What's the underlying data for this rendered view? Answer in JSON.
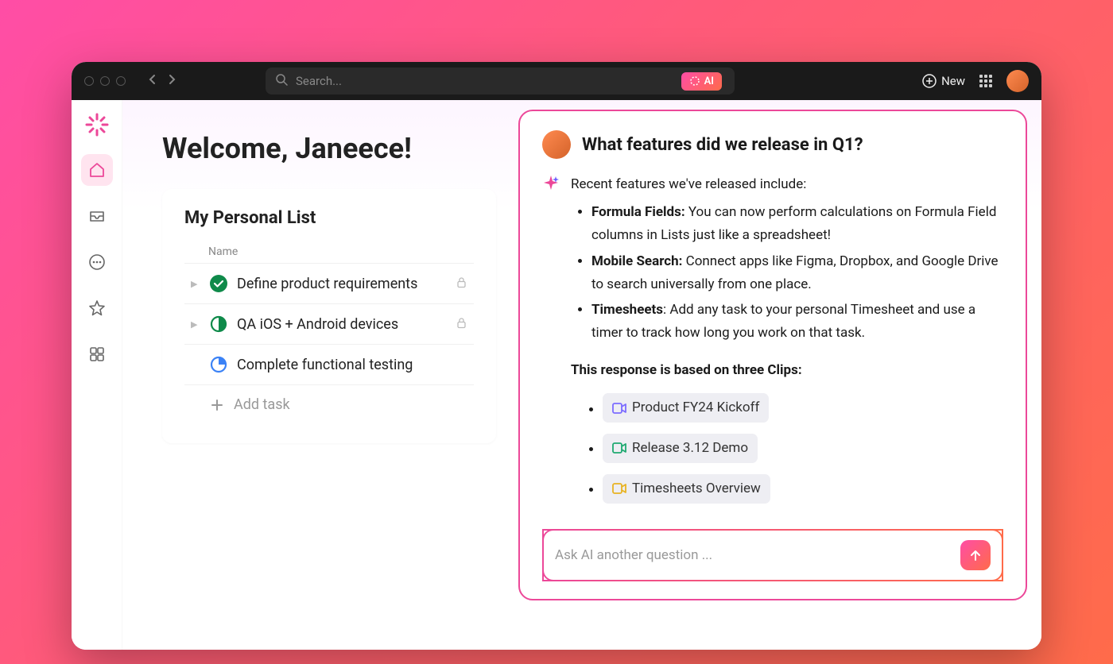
{
  "titlebar": {
    "search_placeholder": "Search...",
    "ai_badge": "AI",
    "new_label": "New"
  },
  "welcome": "Welcome, Janeece!",
  "personal_list": {
    "title": "My Personal List",
    "col_name": "Name",
    "tasks": [
      {
        "label": "Define product requirements",
        "status": "done",
        "locked": true,
        "expandable": true
      },
      {
        "label": "QA iOS + Android devices",
        "status": "half",
        "locked": true,
        "expandable": true
      },
      {
        "label": "Complete functional testing",
        "status": "quarter-blue",
        "locked": false,
        "expandable": false
      }
    ],
    "add_label": "Add task"
  },
  "ai": {
    "question": "What features did we release in Q1?",
    "intro": "Recent features we've released include:",
    "features": [
      {
        "name": "Formula Fields:",
        "desc": " You can now perform calculations on Formula Field columns in Lists just like a spreadsheet!"
      },
      {
        "name": "Mobile Search:",
        "desc": " Connect apps like Figma, Dropbox, and Google Drive to search universally from one place."
      },
      {
        "name": "Timesheets",
        "desc": ": Add any task to your personal Timesheet and use a timer to track how long you work on that task."
      }
    ],
    "clips_title": "This response is based on three Clips:",
    "clips": [
      {
        "label": "Product FY24 Kickoff",
        "color": "#7c6cff"
      },
      {
        "label": "Release 3.12 Demo",
        "color": "#1fa971"
      },
      {
        "label": "Timesheets Overview",
        "color": "#e8b323"
      }
    ],
    "input_placeholder": "Ask AI another question ..."
  }
}
